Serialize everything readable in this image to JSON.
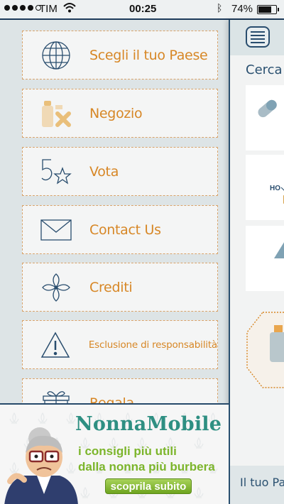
{
  "status_bar": {
    "carrier": "TIM",
    "time": "00:25",
    "battery": "74%",
    "battery_level": 0.74,
    "signal_bars_filled": 4,
    "signal_bars_total": 5
  },
  "menu": {
    "items": [
      {
        "label": "Scegli il tuo Paese",
        "icon": "globe-icon"
      },
      {
        "label": "Negozio",
        "icon": "shop-products-icon"
      },
      {
        "label": "Vota",
        "icon": "five-star-icon"
      },
      {
        "label": "Contact Us",
        "icon": "envelope-icon"
      },
      {
        "label": "Crediti",
        "icon": "pinwheel-icon"
      },
      {
        "label": "Esclusione di responsabilità",
        "icon": "warning-icon"
      },
      {
        "label": "Regala",
        "icon": "gift-icon"
      }
    ]
  },
  "content": {
    "search_label": "Cerca",
    "card_text": "HO",
    "footer_label": "Il tuo Paese"
  },
  "ad": {
    "brand": "NonnaMobile",
    "line1": "i consigli più utili",
    "line2": "dalla nonna più burbera",
    "cta": "scoprila subito"
  },
  "colors": {
    "menu_text": "#d78726",
    "icon_stroke": "#294d6e",
    "brand": "#2e8f82",
    "ad_text": "#7cb52b"
  }
}
